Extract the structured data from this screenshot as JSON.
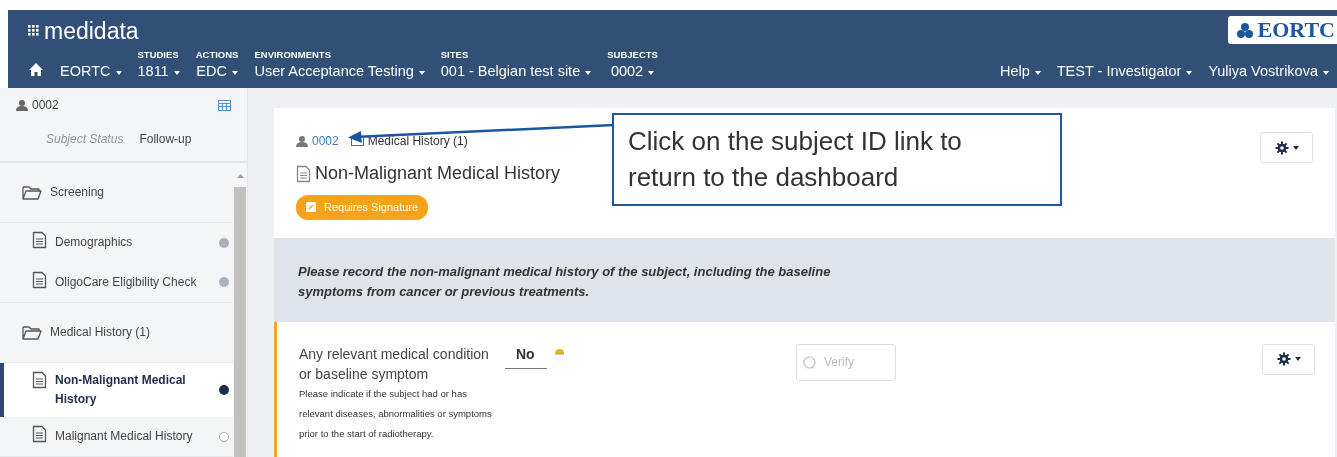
{
  "header": {
    "logo": "medidata",
    "partner_logo": "EORTC"
  },
  "nav": {
    "menus": [
      {
        "value": "EORTC"
      },
      {
        "heading": "STUDIES",
        "value": "1811"
      },
      {
        "heading": "ACTIONS",
        "value": "EDC"
      },
      {
        "heading": "ENVIRONMENTS",
        "value": "User Acceptance Testing"
      },
      {
        "heading": "SITES",
        "value": "001 - Belgian test site"
      },
      {
        "heading": "SUBJECTS",
        "value": "0002"
      }
    ],
    "right_menus": [
      "Help",
      "TEST - Investigator",
      "Yuliya Vostrikova"
    ]
  },
  "sidebar": {
    "subject": "0002",
    "status_label": "Subject Status",
    "status_value": "Follow-up",
    "folders": [
      {
        "name": "Screening",
        "forms": [
          {
            "name": "Demographics",
            "selected": false,
            "filled": true,
            "color": "#a9afbb"
          },
          {
            "name": "OligoCare Eligibility Check",
            "selected": false,
            "filled": true,
            "color": "#a9afbb"
          }
        ]
      },
      {
        "name": "Medical History (1)",
        "forms": [
          {
            "name": "Non-Malignant Medical History",
            "selected": true,
            "filled": true,
            "color": "#1f2d4d"
          },
          {
            "name": "Malignant Medical History",
            "selected": false,
            "filled": false,
            "color": "#a9afbb"
          }
        ]
      }
    ]
  },
  "form": {
    "subject_link": "0002",
    "folder": "Medical History (1)",
    "title": "Non-Malignant Medical History",
    "badge": "Requires Signature",
    "instructions": "Please record the non-malignant medical history of the subject, including the baseline symptoms from cancer or previous treatments.",
    "question": {
      "label": "Any relevant medical condition or baseline symptom",
      "help": "Please indicate if the subject had or has relevant diseases, abnormalities or symptoms prior to the start of radiotherapy.",
      "value": "No",
      "verify": "Verify"
    }
  },
  "callout": {
    "text": "Click on the subject ID link to return to the dashboard"
  }
}
